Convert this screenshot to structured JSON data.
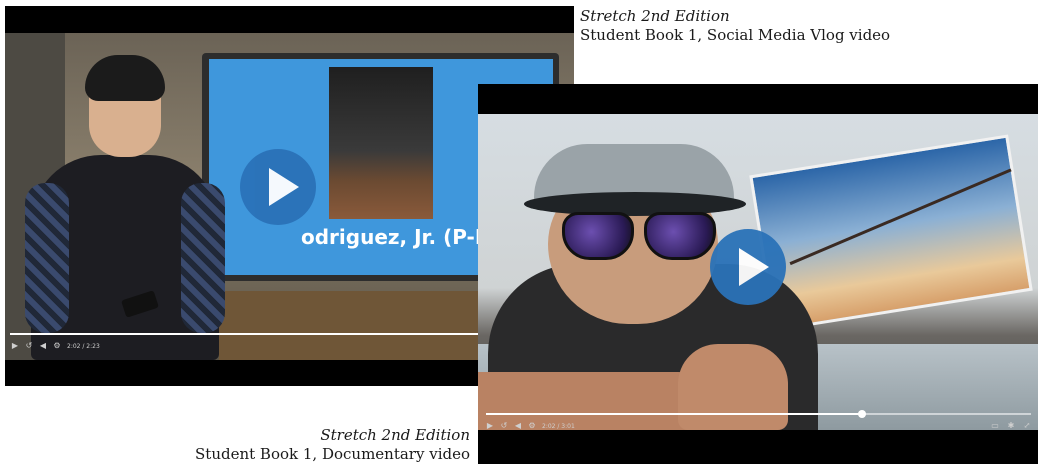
{
  "captions": {
    "top": {
      "edition": "Stretch 2nd Edition",
      "title": "Student Book 1, Social Media Vlog video"
    },
    "bottom": {
      "edition": "Stretch 2nd Edition",
      "title": "Student Book 1, Documentary video"
    }
  },
  "player1": {
    "tv_caption": "odriguez, Jr. (P-Ro",
    "time": "2:02 / 2:23",
    "progress": 0.99
  },
  "player2": {
    "time": "2:02 / 3:01",
    "progress": 0.69
  },
  "icons": {
    "play": "play-icon",
    "replay": "replay-icon",
    "volume": "volume-icon",
    "captions": "captions-icon",
    "settings": "settings-icon",
    "fullscreen": "fullscreen-icon"
  },
  "colors": {
    "play_button": "#2a72b8",
    "tv_screen": "#3f97dc"
  }
}
